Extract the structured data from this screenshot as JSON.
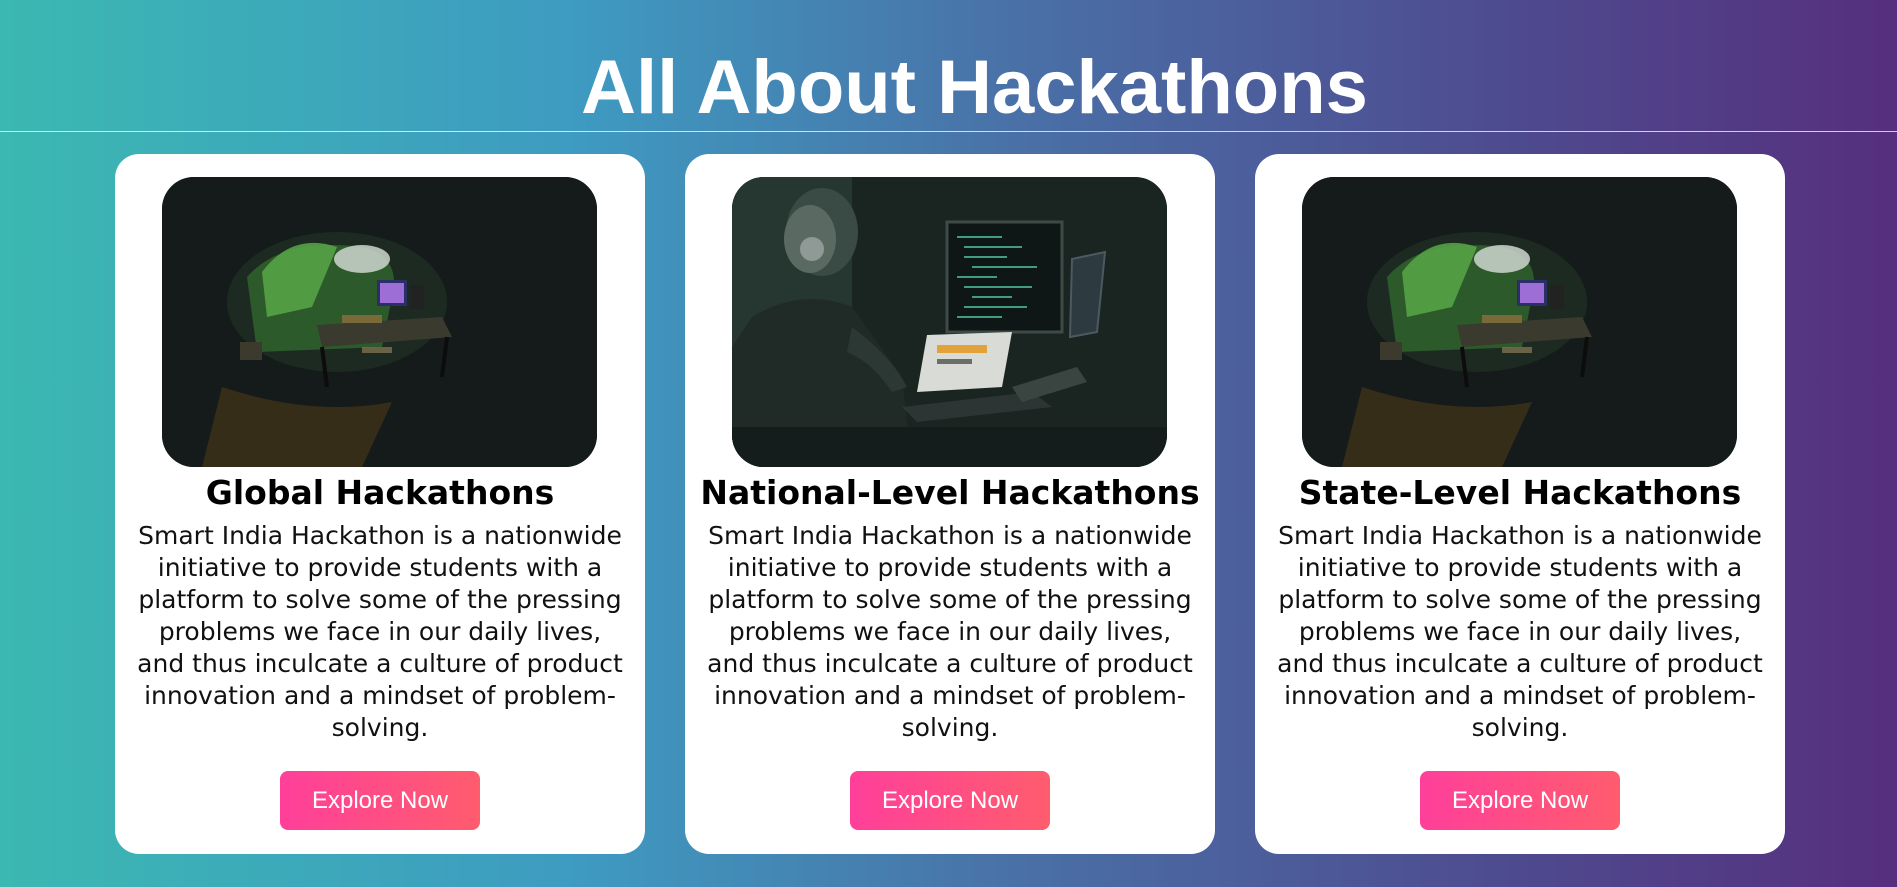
{
  "page": {
    "title": "All About Hackathons"
  },
  "colors": {
    "gradient_start": "#3bb8b2",
    "gradient_end": "#562f7e",
    "card_background": "#ffffff",
    "button_gradient_start": "#ff3f9a",
    "button_gradient_end": "#ff5c6e",
    "button_text": "#ffffff"
  },
  "cards": [
    {
      "title": "Global Hackathons",
      "image_icon": "desk-setup-photo",
      "description": "Smart India Hackathon is a nationwide initiative to provide students with a platform to solve some of the pressing problems we face in our daily lives, and thus inculcate a culture of product innovation and a mindset of problem-solving.",
      "button_label": "Explore Now"
    },
    {
      "title": "National-Level Hackathons",
      "image_icon": "coder-at-monitors-photo",
      "description": "Smart India Hackathon is a nationwide initiative to provide students with a platform to solve some of the pressing problems we face in our daily lives, and thus inculcate a culture of product innovation and a mindset of problem-solving.",
      "button_label": "Explore Now"
    },
    {
      "title": "State-Level Hackathons",
      "image_icon": "desk-setup-photo",
      "description": "Smart India Hackathon is a nationwide initiative to provide students with a platform to solve some of the pressing problems we face in our daily lives, and thus inculcate a culture of product innovation and a mindset of problem-solving.",
      "button_label": "Explore Now"
    }
  ]
}
